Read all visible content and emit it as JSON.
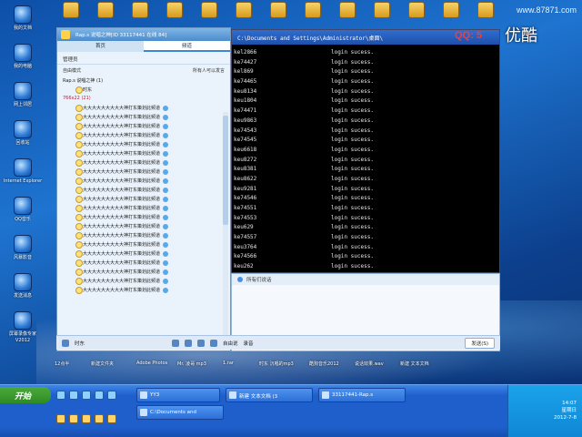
{
  "watermark": "www.87871.com",
  "top_icons": [
    {
      "label": "",
      "icon": "folder-icon"
    },
    {
      "label": "",
      "icon": "folder-icon"
    },
    {
      "label": "",
      "icon": "folder-icon"
    },
    {
      "label": "",
      "icon": "folder-icon"
    },
    {
      "label": "",
      "icon": "app-icon"
    },
    {
      "label": "",
      "icon": "app-icon"
    },
    {
      "label": "",
      "icon": "app-icon"
    },
    {
      "label": "",
      "icon": "app-icon"
    },
    {
      "label": "",
      "icon": "app-icon"
    },
    {
      "label": "",
      "icon": "app-icon"
    },
    {
      "label": "",
      "icon": "qq-penguin-icon"
    },
    {
      "label": "",
      "icon": "document-icon"
    },
    {
      "label": "",
      "icon": "app-icon"
    }
  ],
  "left_icons": [
    {
      "label": "我的文档",
      "icon": "my-documents-icon"
    },
    {
      "label": "我的电脑",
      "icon": "my-computer-icon"
    },
    {
      "label": "网上邻居",
      "icon": "network-icon"
    },
    {
      "label": "回收站",
      "icon": "recycle-bin-icon"
    },
    {
      "label": "Internet Explorer",
      "icon": "internet-explorer-icon"
    },
    {
      "label": "QQ音乐",
      "icon": "music-icon"
    },
    {
      "label": "风暴影音",
      "icon": "media-icon"
    },
    {
      "label": "发送消息",
      "icon": "message-icon"
    },
    {
      "label": "屏幕录像专家V2012",
      "icon": "screen-recorder-icon"
    }
  ],
  "qq_window": {
    "title": "Rap.s 说唱之神[ID 33117441 在线 84]",
    "tabs": [
      "首页",
      "频道"
    ],
    "admin_label": "管理员",
    "mode_label": "自由模式",
    "mode_right": "所有人可以发言",
    "group_name": "Rap.s 说唱之神 (1)",
    "group_member": "时东",
    "subgroup": "766x22 (21)",
    "members": [
      "大大大大大大大大大神打东策划此频道",
      "大大大大大大大大大神打东策划此频道",
      "大大大大大大大大大神打东策划此频道",
      "大大大大大大大大大神打东策划此频道",
      "大大大大大大大大大神打东策划此频道",
      "大大大大大大大大大神打东策划此频道",
      "大大大大大大大大大神打东策划此频道",
      "大大大大大大大大大神打东策划此频道",
      "大大大大大大大大大神打东策划此频道",
      "大大大大大大大大大神打东策划此频道",
      "大大大大大大大大大神打东策划此频道",
      "大大大大大大大大大神打东策划此频道",
      "大大大大大大大大大神打东策划此频道",
      "大大大大大大大大大神打东策划此频道",
      "大大大大大大大大大神打东策划此频道",
      "大大大大大大大大大神打东策划此频道",
      "大大大大大大大大大神打东策划此频道",
      "大大大大大大大大大神打东策划此频道",
      "大大大大大大大大大神打东策划此频道",
      "大大大大大大大大大神打东策划此频道",
      "大大大大大大大大大神打东策划此频道"
    ]
  },
  "console": {
    "title": "C:\\Documents and Settings\\Administrator\\桌面\\",
    "qq_badge": "QQ: 5",
    "qq_badge_tail": "8",
    "youku_logo": "优酷",
    "rows": [
      {
        "user": "kel2866",
        "status": "login sucess."
      },
      {
        "user": "ke74427",
        "status": "login sucess."
      },
      {
        "user": "kel869",
        "status": "login sucess."
      },
      {
        "user": "ke74465",
        "status": "login sucess."
      },
      {
        "user": "keu8134",
        "status": "login sucess."
      },
      {
        "user": "keu1804",
        "status": "login sucess."
      },
      {
        "user": "ke74471",
        "status": "login sucess."
      },
      {
        "user": "keu9863",
        "status": "login sucess."
      },
      {
        "user": "ke74543",
        "status": "login sucess."
      },
      {
        "user": "ke74545",
        "status": "login sucess."
      },
      {
        "user": "keu6618",
        "status": "login sucess."
      },
      {
        "user": "keu8272",
        "status": "login sucess."
      },
      {
        "user": "keu8381",
        "status": "login sucess."
      },
      {
        "user": "keu8622",
        "status": "login sucess."
      },
      {
        "user": "keu9281",
        "status": "login sucess."
      },
      {
        "user": "ke74546",
        "status": "login sucess."
      },
      {
        "user": "ke74551",
        "status": "login sucess."
      },
      {
        "user": "ke74553",
        "status": "login sucess."
      },
      {
        "user": "keu629",
        "status": "login sucess."
      },
      {
        "user": "ke74557",
        "status": "login sucess."
      },
      {
        "user": "keu3764",
        "status": "login sucess."
      },
      {
        "user": "ke74566",
        "status": "login sucess."
      },
      {
        "user": "keu262",
        "status": "login sucess."
      },
      {
        "user": "keu3756",
        "status": "login sucess."
      }
    ]
  },
  "chat_pane": {
    "bar_text": "所有们说话"
  },
  "toolbar": {
    "user": "时东",
    "free_mic": "自由说",
    "audio": "录音",
    "send_label": "发送(S)"
  },
  "taskbar": {
    "start_label": "开始",
    "buttons": [
      "YY3",
      "新建 文本文档 (3",
      "33117441-Rap.s",
      "C:\\Documents and"
    ],
    "clock_time": "14:07",
    "clock_day": "星期日",
    "clock_date": "2012-7-8"
  },
  "desk_bottom_labels": [
    "12点半",
    "新建文件夹",
    "Adobe Photos",
    "Mr. 凌哥 mp3",
    "1.rar",
    "时东 沉唱的mp3",
    "酷狗音乐2012",
    "说话效果.wav",
    "新建 文本文档"
  ]
}
